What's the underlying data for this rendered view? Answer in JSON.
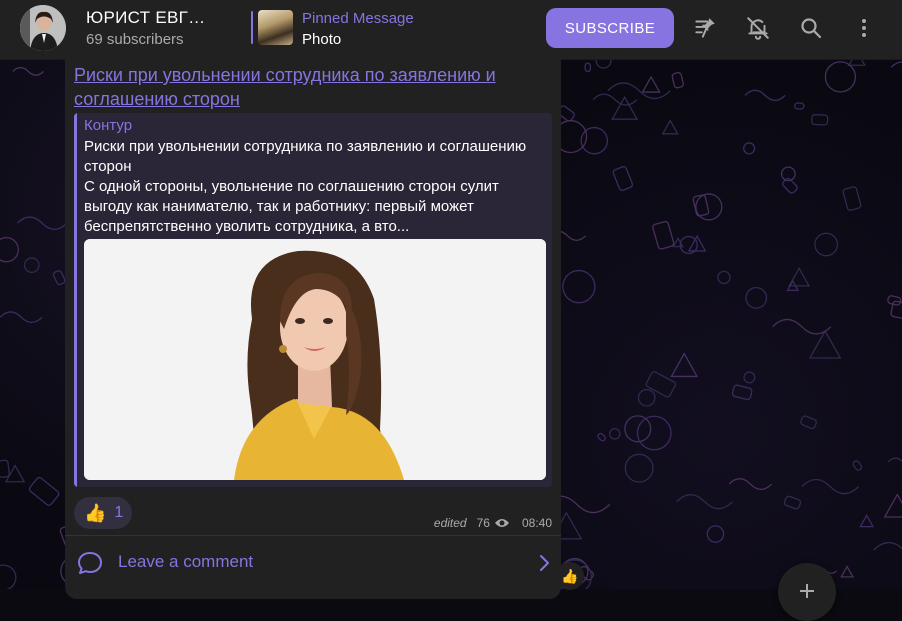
{
  "header": {
    "channel_title": "ЮРИСТ ЕВГ…",
    "subscribers": "69 subscribers",
    "pinned_label": "Pinned Message",
    "pinned_text": "Photo",
    "subscribe_label": "SUBSCRIBE",
    "icons": [
      "unpin-icon",
      "mute-icon",
      "search-icon",
      "more-icon"
    ]
  },
  "message": {
    "link_text": "Риски при увольнении сотрудника по заявлению и соглашению сторон",
    "preview": {
      "site_name": "Контур",
      "title": "Риски при увольнении сотрудника по заявлению и соглашению сторон",
      "description": "С одной стороны, увольнение по соглашению сторон сулит выгоду как нанимателю, так и работнику: первый может беспрепятственно уволить сотрудника, а вто..."
    },
    "reaction": {
      "emoji": "👍",
      "count": "1"
    },
    "edited_label": "edited",
    "views": "76",
    "time": "08:40",
    "comment_label": "Leave a comment"
  },
  "colors": {
    "accent": "#8774e1",
    "bubble": "#212121",
    "header": "#212121"
  }
}
